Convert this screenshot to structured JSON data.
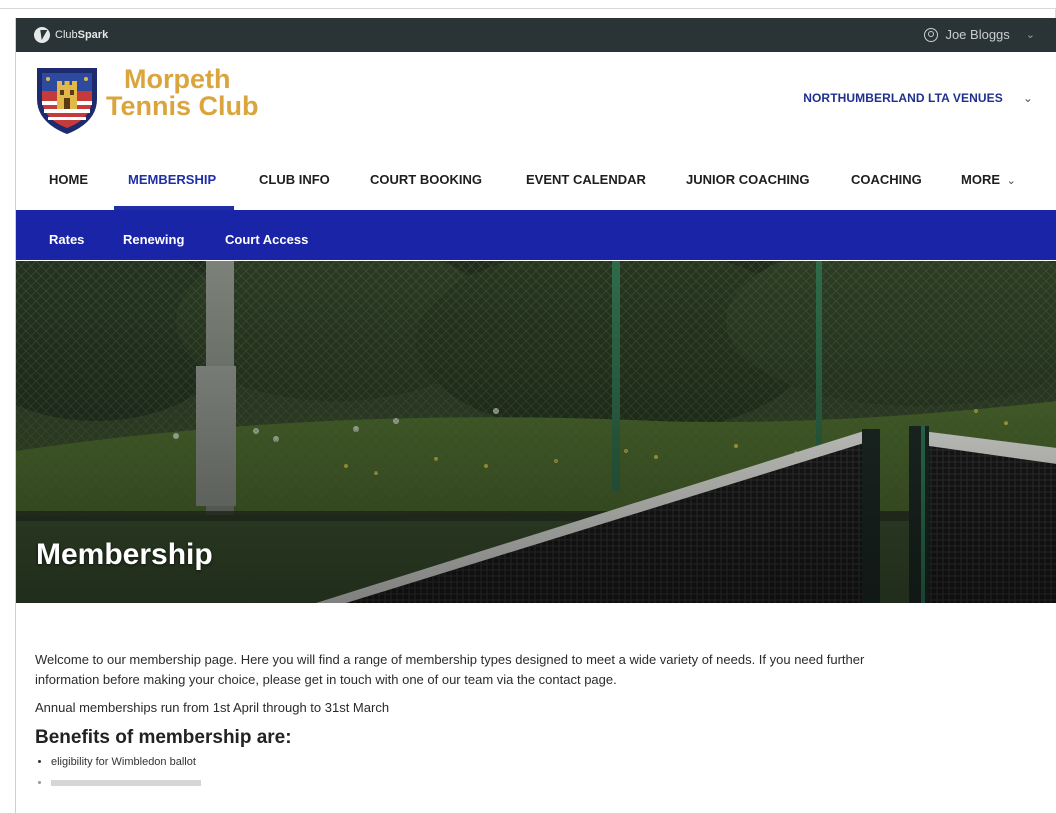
{
  "topbar": {
    "brand_prefix": "Club",
    "brand_suffix": "Spark",
    "user_name": "Joe Bloggs",
    "user_icon": "user-circle-icon",
    "chevron_icon": "chevron-down-icon"
  },
  "header": {
    "club_name_line1": "Morpeth",
    "club_name_line2": "Tennis Club",
    "venues_label": "NORTHUMBERLAND LTA VENUES"
  },
  "nav": {
    "items": [
      {
        "label": "HOME"
      },
      {
        "label": "MEMBERSHIP"
      },
      {
        "label": "CLUB INFO"
      },
      {
        "label": "COURT BOOKING"
      },
      {
        "label": "EVENT CALENDAR"
      },
      {
        "label": "JUNIOR COACHING"
      },
      {
        "label": "COACHING"
      },
      {
        "label": "MORE"
      }
    ],
    "active_index": 1
  },
  "subnav": {
    "items": [
      {
        "label": "Rates"
      },
      {
        "label": "Renewing"
      },
      {
        "label": "Court Access"
      }
    ]
  },
  "hero": {
    "title": "Membership"
  },
  "content": {
    "intro": "Welcome to our membership page. Here you will find a range of membership types designed to meet a wide variety of needs. If you need further information before making your choice, please get in touch with one of our team via the contact page.",
    "annual": "Annual memberships run from 1st April through to 31st March",
    "benefits_heading": "Benefits of membership are:",
    "benefits": [
      "eligibility for Wimbledon ballot"
    ]
  },
  "colors": {
    "topbar_bg": "#2a3436",
    "brand_gold": "#d9a53c",
    "primary_blue": "#1f2fa8",
    "subnav_bg": "#1a24a6"
  }
}
